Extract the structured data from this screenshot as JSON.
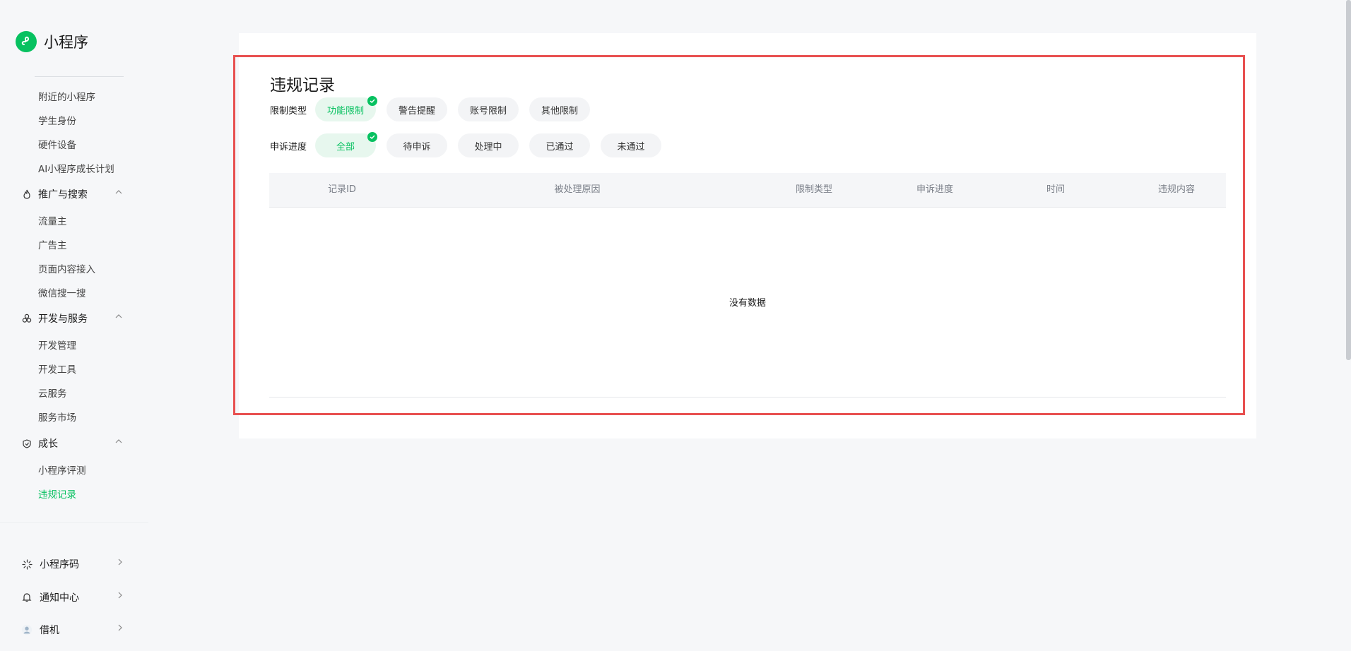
{
  "app": {
    "name": "小程序"
  },
  "sidebar": {
    "top_items": [
      "附近的小程序",
      "学生身份",
      "硬件设备",
      "AI小程序成长计划"
    ],
    "groups": [
      {
        "label": "推广与搜索",
        "icon": "flame-icon",
        "items": [
          "流量主",
          "广告主",
          "页面内容接入",
          "微信搜一搜"
        ]
      },
      {
        "label": "开发与服务",
        "icon": "service-cluster-icon",
        "items": [
          "开发管理",
          "开发工具",
          "云服务",
          "服务市场"
        ]
      },
      {
        "label": "成长",
        "icon": "growth-leaf-icon",
        "items": [
          "小程序评测",
          "违规记录"
        ]
      }
    ],
    "active_item": "违规记录",
    "bottom": [
      {
        "label": "小程序码",
        "icon": "qrcode-sparkle-icon"
      },
      {
        "label": "通知中心",
        "icon": "bell-icon"
      },
      {
        "label": "借机",
        "icon": "user-avatar-icon"
      }
    ]
  },
  "main": {
    "title": "违规记录",
    "filters": {
      "restriction": {
        "label": "限制类型",
        "options": [
          "功能限制",
          "警告提醒",
          "账号限制",
          "其他限制"
        ],
        "selected": "功能限制"
      },
      "appeal": {
        "label": "申诉进度",
        "options": [
          "全部",
          "待申诉",
          "处理中",
          "已通过",
          "未通过"
        ],
        "selected": "全部"
      }
    },
    "table": {
      "columns": [
        "记录ID",
        "被处理原因",
        "限制类型",
        "申诉进度",
        "时间",
        "违规内容"
      ],
      "rows": [],
      "empty_text": "没有数据"
    }
  },
  "colors": {
    "accent": "#07c160",
    "highlight_border": "#e85050",
    "page_bg": "#f6f7f9"
  }
}
